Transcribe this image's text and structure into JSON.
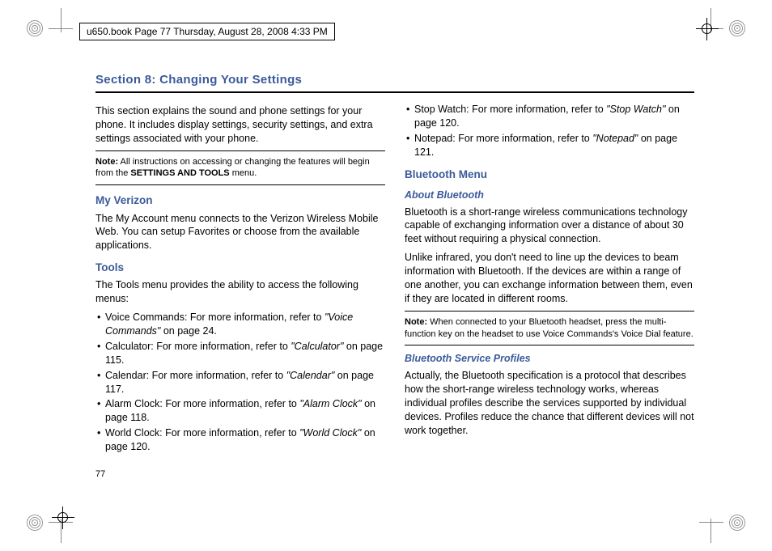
{
  "header": {
    "text": "u650.book  Page 77  Thursday, August 28, 2008  4:33 PM"
  },
  "section": {
    "title": "Section 8: Changing Your Settings"
  },
  "left": {
    "intro": "This section explains the sound and phone settings for your phone. It includes display settings, security settings, and extra settings associated with your phone.",
    "note": {
      "label": "Note:",
      "text": " All instructions on accessing or changing the features will begin from the ",
      "bold": "SETTINGS AND TOOLS",
      "tail": " menu."
    },
    "h1": "My Verizon",
    "p1": "The My Account menu connects to the Verizon Wireless Mobile Web. You can setup Favorites or choose from the available applications.",
    "h2": "Tools",
    "p2": "The Tools menu provides the ability to access the following menus:",
    "items": [
      {
        "pre": "Voice Commands: For more information, refer to ",
        "ref": "\"Voice Commands\"",
        "post": "  on page 24."
      },
      {
        "pre": "Calculator: For more information, refer to ",
        "ref": "\"Calculator\"",
        "post": "  on page 115."
      },
      {
        "pre": "Calendar: For more information, refer to ",
        "ref": "\"Calendar\"",
        "post": "  on page 117."
      },
      {
        "pre": "Alarm Clock: For more information, refer to ",
        "ref": "\"Alarm Clock\"",
        "post": "  on page 118."
      },
      {
        "pre": "World Clock: For more information, refer to ",
        "ref": "\"World Clock\"",
        "post": "  on page 120."
      }
    ]
  },
  "right": {
    "items": [
      {
        "pre": "Stop Watch: For more information, refer to ",
        "ref": "\"Stop Watch\"",
        "post": "  on page 120."
      },
      {
        "pre": "Notepad: For more information, refer to ",
        "ref": "\"Notepad\"",
        "post": "  on page 121."
      }
    ],
    "h1": "Bluetooth Menu",
    "sub1": "About Bluetooth",
    "p1": "Bluetooth is a short-range wireless communications technology capable of exchanging information over a distance of about 30 feet without requiring a physical connection.",
    "p2": "Unlike infrared, you don't need to line up the devices to beam information with Bluetooth. If the devices are within a range of one another, you can exchange information between them, even if they are located in different rooms.",
    "note": {
      "label": "Note:",
      "text": " When connected to your Bluetooth headset, press the multi-function key on the headset to use Voice Commands's Voice Dial feature."
    },
    "sub2": "Bluetooth Service Profiles",
    "p3": "Actually, the Bluetooth specification is a protocol that describes how the short-range wireless technology works, whereas individual profiles describe the services supported by individual devices. Profiles reduce the chance that different devices will not work together."
  },
  "pagenum": "77"
}
